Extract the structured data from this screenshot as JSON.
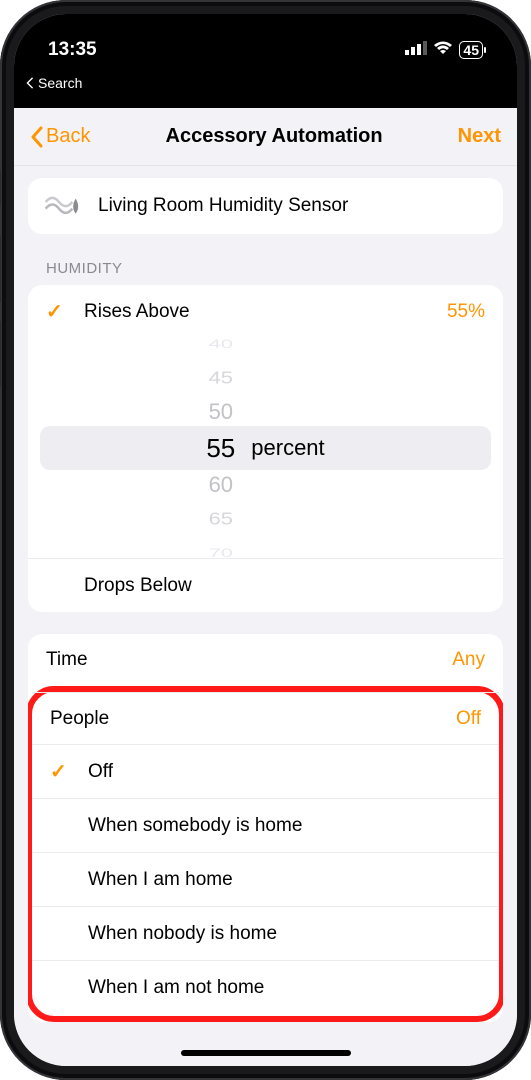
{
  "status": {
    "time": "13:35",
    "battery": "45",
    "back_app": "Search"
  },
  "nav": {
    "back": "Back",
    "title": "Accessory Automation",
    "next": "Next"
  },
  "accessory": {
    "name": "Living Room Humidity Sensor"
  },
  "humidity": {
    "section_label": "HUMIDITY",
    "rises": {
      "label": "Rises Above",
      "value": "55%"
    },
    "drops": {
      "label": "Drops Below"
    },
    "picker": {
      "values": [
        "40",
        "45",
        "50",
        "55",
        "60",
        "65",
        "70"
      ],
      "selected": "55",
      "unit": "percent"
    }
  },
  "time_row": {
    "label": "Time",
    "value": "Any"
  },
  "people": {
    "label": "People",
    "value": "Off",
    "options": [
      {
        "label": "Off",
        "selected": true
      },
      {
        "label": "When somebody is home",
        "selected": false
      },
      {
        "label": "When I am home",
        "selected": false
      },
      {
        "label": "When nobody is home",
        "selected": false
      },
      {
        "label": "When I am not home",
        "selected": false
      }
    ]
  }
}
